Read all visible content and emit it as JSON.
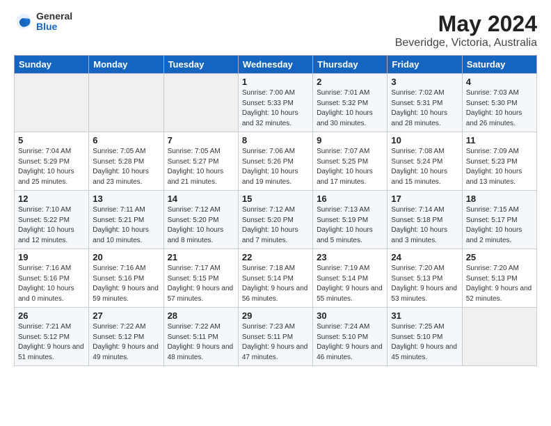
{
  "logo": {
    "general": "General",
    "blue": "Blue"
  },
  "title": "May 2024",
  "subtitle": "Beveridge, Victoria, Australia",
  "days_of_week": [
    "Sunday",
    "Monday",
    "Tuesday",
    "Wednesday",
    "Thursday",
    "Friday",
    "Saturday"
  ],
  "weeks": [
    [
      {
        "day": null,
        "sunrise": "",
        "sunset": "",
        "daylight": ""
      },
      {
        "day": null,
        "sunrise": "",
        "sunset": "",
        "daylight": ""
      },
      {
        "day": null,
        "sunrise": "",
        "sunset": "",
        "daylight": ""
      },
      {
        "day": "1",
        "sunrise": "Sunrise: 7:00 AM",
        "sunset": "Sunset: 5:33 PM",
        "daylight": "Daylight: 10 hours and 32 minutes."
      },
      {
        "day": "2",
        "sunrise": "Sunrise: 7:01 AM",
        "sunset": "Sunset: 5:32 PM",
        "daylight": "Daylight: 10 hours and 30 minutes."
      },
      {
        "day": "3",
        "sunrise": "Sunrise: 7:02 AM",
        "sunset": "Sunset: 5:31 PM",
        "daylight": "Daylight: 10 hours and 28 minutes."
      },
      {
        "day": "4",
        "sunrise": "Sunrise: 7:03 AM",
        "sunset": "Sunset: 5:30 PM",
        "daylight": "Daylight: 10 hours and 26 minutes."
      }
    ],
    [
      {
        "day": "5",
        "sunrise": "Sunrise: 7:04 AM",
        "sunset": "Sunset: 5:29 PM",
        "daylight": "Daylight: 10 hours and 25 minutes."
      },
      {
        "day": "6",
        "sunrise": "Sunrise: 7:05 AM",
        "sunset": "Sunset: 5:28 PM",
        "daylight": "Daylight: 10 hours and 23 minutes."
      },
      {
        "day": "7",
        "sunrise": "Sunrise: 7:05 AM",
        "sunset": "Sunset: 5:27 PM",
        "daylight": "Daylight: 10 hours and 21 minutes."
      },
      {
        "day": "8",
        "sunrise": "Sunrise: 7:06 AM",
        "sunset": "Sunset: 5:26 PM",
        "daylight": "Daylight: 10 hours and 19 minutes."
      },
      {
        "day": "9",
        "sunrise": "Sunrise: 7:07 AM",
        "sunset": "Sunset: 5:25 PM",
        "daylight": "Daylight: 10 hours and 17 minutes."
      },
      {
        "day": "10",
        "sunrise": "Sunrise: 7:08 AM",
        "sunset": "Sunset: 5:24 PM",
        "daylight": "Daylight: 10 hours and 15 minutes."
      },
      {
        "day": "11",
        "sunrise": "Sunrise: 7:09 AM",
        "sunset": "Sunset: 5:23 PM",
        "daylight": "Daylight: 10 hours and 13 minutes."
      }
    ],
    [
      {
        "day": "12",
        "sunrise": "Sunrise: 7:10 AM",
        "sunset": "Sunset: 5:22 PM",
        "daylight": "Daylight: 10 hours and 12 minutes."
      },
      {
        "day": "13",
        "sunrise": "Sunrise: 7:11 AM",
        "sunset": "Sunset: 5:21 PM",
        "daylight": "Daylight: 10 hours and 10 minutes."
      },
      {
        "day": "14",
        "sunrise": "Sunrise: 7:12 AM",
        "sunset": "Sunset: 5:20 PM",
        "daylight": "Daylight: 10 hours and 8 minutes."
      },
      {
        "day": "15",
        "sunrise": "Sunrise: 7:12 AM",
        "sunset": "Sunset: 5:20 PM",
        "daylight": "Daylight: 10 hours and 7 minutes."
      },
      {
        "day": "16",
        "sunrise": "Sunrise: 7:13 AM",
        "sunset": "Sunset: 5:19 PM",
        "daylight": "Daylight: 10 hours and 5 minutes."
      },
      {
        "day": "17",
        "sunrise": "Sunrise: 7:14 AM",
        "sunset": "Sunset: 5:18 PM",
        "daylight": "Daylight: 10 hours and 3 minutes."
      },
      {
        "day": "18",
        "sunrise": "Sunrise: 7:15 AM",
        "sunset": "Sunset: 5:17 PM",
        "daylight": "Daylight: 10 hours and 2 minutes."
      }
    ],
    [
      {
        "day": "19",
        "sunrise": "Sunrise: 7:16 AM",
        "sunset": "Sunset: 5:16 PM",
        "daylight": "Daylight: 10 hours and 0 minutes."
      },
      {
        "day": "20",
        "sunrise": "Sunrise: 7:16 AM",
        "sunset": "Sunset: 5:16 PM",
        "daylight": "Daylight: 9 hours and 59 minutes."
      },
      {
        "day": "21",
        "sunrise": "Sunrise: 7:17 AM",
        "sunset": "Sunset: 5:15 PM",
        "daylight": "Daylight: 9 hours and 57 minutes."
      },
      {
        "day": "22",
        "sunrise": "Sunrise: 7:18 AM",
        "sunset": "Sunset: 5:14 PM",
        "daylight": "Daylight: 9 hours and 56 minutes."
      },
      {
        "day": "23",
        "sunrise": "Sunrise: 7:19 AM",
        "sunset": "Sunset: 5:14 PM",
        "daylight": "Daylight: 9 hours and 55 minutes."
      },
      {
        "day": "24",
        "sunrise": "Sunrise: 7:20 AM",
        "sunset": "Sunset: 5:13 PM",
        "daylight": "Daylight: 9 hours and 53 minutes."
      },
      {
        "day": "25",
        "sunrise": "Sunrise: 7:20 AM",
        "sunset": "Sunset: 5:13 PM",
        "daylight": "Daylight: 9 hours and 52 minutes."
      }
    ],
    [
      {
        "day": "26",
        "sunrise": "Sunrise: 7:21 AM",
        "sunset": "Sunset: 5:12 PM",
        "daylight": "Daylight: 9 hours and 51 minutes."
      },
      {
        "day": "27",
        "sunrise": "Sunrise: 7:22 AM",
        "sunset": "Sunset: 5:12 PM",
        "daylight": "Daylight: 9 hours and 49 minutes."
      },
      {
        "day": "28",
        "sunrise": "Sunrise: 7:22 AM",
        "sunset": "Sunset: 5:11 PM",
        "daylight": "Daylight: 9 hours and 48 minutes."
      },
      {
        "day": "29",
        "sunrise": "Sunrise: 7:23 AM",
        "sunset": "Sunset: 5:11 PM",
        "daylight": "Daylight: 9 hours and 47 minutes."
      },
      {
        "day": "30",
        "sunrise": "Sunrise: 7:24 AM",
        "sunset": "Sunset: 5:10 PM",
        "daylight": "Daylight: 9 hours and 46 minutes."
      },
      {
        "day": "31",
        "sunrise": "Sunrise: 7:25 AM",
        "sunset": "Sunset: 5:10 PM",
        "daylight": "Daylight: 9 hours and 45 minutes."
      },
      {
        "day": null,
        "sunrise": "",
        "sunset": "",
        "daylight": ""
      }
    ]
  ]
}
